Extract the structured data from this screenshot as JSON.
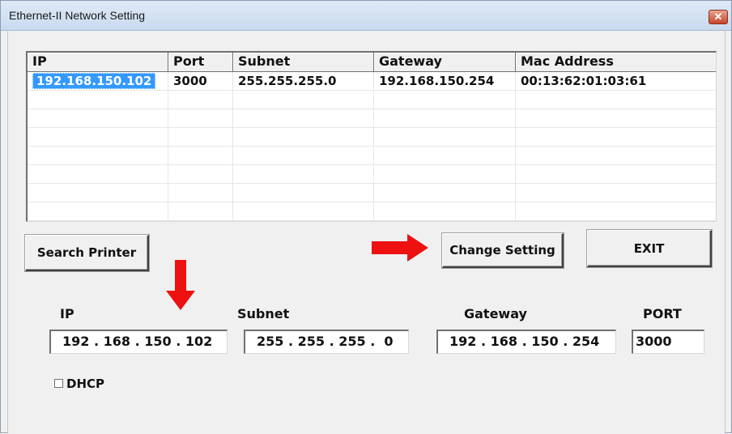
{
  "window": {
    "title": "Ethernet-II Network Setting",
    "close_glyph": "✕"
  },
  "list": {
    "columns": [
      "IP",
      "Port",
      "Subnet",
      "Gateway",
      "Mac Address"
    ],
    "rows": [
      {
        "ip": "192.168.150.102",
        "port": "3000",
        "subnet": "255.255.255.0",
        "gateway": "192.168.150.254",
        "mac": "00:13:62:01:03:61"
      }
    ]
  },
  "buttons": {
    "search": "Search Printer",
    "change": "Change Setting",
    "exit": "EXIT"
  },
  "form": {
    "ip_label": "IP",
    "subnet_label": "Subnet",
    "gateway_label": "Gateway",
    "port_label": "PORT",
    "ip_value": "192 . 168 . 150 . 102",
    "subnet_value": "255 . 255 . 255 .  0",
    "gateway_value": "192 . 168 . 150 . 254",
    "port_value": "3000",
    "dhcp_label": "DHCP"
  },
  "annotations": {
    "arrow_color": "#ee1111"
  }
}
